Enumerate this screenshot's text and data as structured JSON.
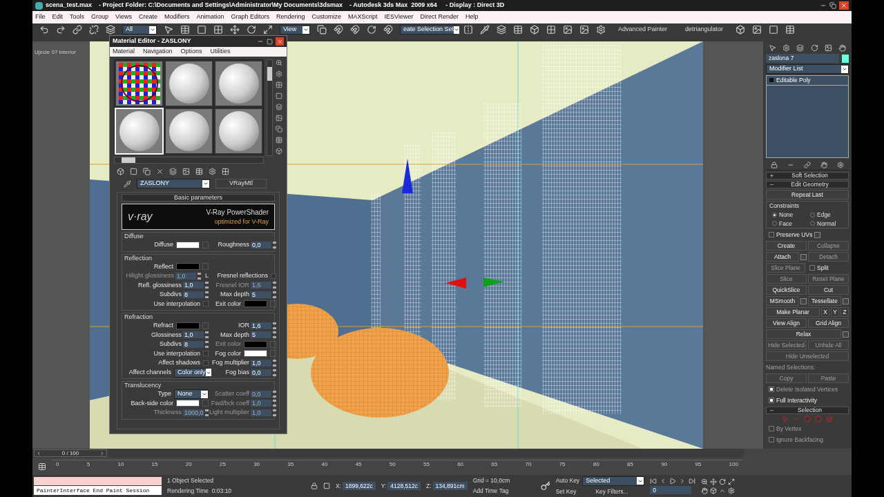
{
  "window": {
    "title": "scena_test.max    - Project Folder: C:\\Documents and Settings\\Administrator\\My Documents\\3dsmax    - Autodesk 3ds Max  2009 x64     - Display : Direct 3D"
  },
  "menu": [
    "File",
    "Edit",
    "Tools",
    "Group",
    "Views",
    "Create",
    "Modifiers",
    "Animation",
    "Graph Editors",
    "Rendering",
    "Customize",
    "MAXScript",
    "IESViewer",
    "Direct Render",
    "Help"
  ],
  "toolbar": {
    "selection_filter": "All",
    "reference_coord": "View",
    "named_selection": "eate Selection Set",
    "buttons": [
      "Advanced Painter",
      "detriangulator"
    ]
  },
  "viewport": {
    "label": "Ujecie 07 interior"
  },
  "material_editor": {
    "title": "Material Editor - ZASLONY",
    "menu": [
      "Material",
      "Navigation",
      "Options",
      "Utilities"
    ],
    "slots": [
      {
        "kind": "checker",
        "selected": false
      },
      {
        "kind": "sphere",
        "selected": false
      },
      {
        "kind": "sphere",
        "selected": false
      },
      {
        "kind": "sphere",
        "selected": true
      },
      {
        "kind": "sphere",
        "selected": false
      },
      {
        "kind": "sphere",
        "selected": false
      }
    ],
    "material_name": "ZASLONY",
    "material_type": "VRayMtl",
    "rollout": "Basic parameters",
    "banner": {
      "logo": "v·ray",
      "title": "V-Ray PowerShader",
      "subtitle": "optimized for V-Ray"
    },
    "groups": [
      {
        "title": "Diffuse",
        "rows": [
          {
            "left": {
              "kind": "color",
              "label": "Diffuse",
              "color": "#ffffff",
              "disabled": false
            },
            "right": {
              "kind": "spinner",
              "label": "Roughness",
              "value": "0,0",
              "disabled": false
            }
          }
        ]
      },
      {
        "title": "Reflection",
        "rows": [
          {
            "left": {
              "kind": "color",
              "label": "Reflect",
              "color": "#000000",
              "disabled": false
            }
          },
          {
            "left": {
              "kind": "spinner",
              "label": "Hilight glossiness",
              "value": "1,0",
              "disabled": true,
              "lock": "L"
            },
            "right": {
              "kind": "checkbox",
              "label": "Fresnel reflections",
              "checked": false,
              "disabled": false
            }
          },
          {
            "left": {
              "kind": "spinner",
              "label": "Refl. glossiness",
              "value": "1,0",
              "disabled": false
            },
            "right": {
              "kind": "spinner",
              "label": "Fresnel IOR",
              "value": "1,6",
              "disabled": true
            }
          },
          {
            "left": {
              "kind": "spinner",
              "label": "Subdivs",
              "value": "8",
              "disabled": false
            },
            "right": {
              "kind": "spinner",
              "label": "Max depth",
              "value": "5",
              "disabled": false
            }
          },
          {
            "left": {
              "kind": "checkbox",
              "label": "Use interpolation",
              "checked": false,
              "disabled": false
            },
            "right": {
              "kind": "color",
              "label": "Exit color",
              "color": "#000000",
              "disabled": false
            }
          }
        ]
      },
      {
        "title": "Refraction",
        "rows": [
          {
            "left": {
              "kind": "color",
              "label": "Refract",
              "color": "#000000",
              "disabled": false
            },
            "right": {
              "kind": "spinner",
              "label": "IOR",
              "value": "1,6",
              "disabled": false
            }
          },
          {
            "left": {
              "kind": "spinner",
              "label": "Glossiness",
              "value": "1,0",
              "disabled": false
            },
            "right": {
              "kind": "spinner",
              "label": "Max depth",
              "value": "5",
              "disabled": false
            }
          },
          {
            "left": {
              "kind": "spinner",
              "label": "Subdivs",
              "value": "8",
              "disabled": false
            },
            "right": {
              "kind": "color",
              "label": "Exit color",
              "color": "#000000",
              "disabled": true
            }
          },
          {
            "left": {
              "kind": "checkbox",
              "label": "Use interpolation",
              "checked": false,
              "disabled": false
            },
            "right": {
              "kind": "color",
              "label": "Fog color",
              "color": "#ffffff",
              "disabled": false
            }
          },
          {
            "left": {
              "kind": "checkbox",
              "label": "Affect shadows",
              "checked": false,
              "disabled": false
            },
            "right": {
              "kind": "spinner",
              "label": "Fog multiplier",
              "value": "1,0",
              "disabled": false
            }
          },
          {
            "left": {
              "kind": "dropdown",
              "label": "Affect channels",
              "value": "Color only",
              "disabled": false
            },
            "right": {
              "kind": "spinner",
              "label": "Fog bias",
              "value": "0,0",
              "disabled": false
            }
          }
        ]
      },
      {
        "title": "Translucency",
        "rows": [
          {
            "left": {
              "kind": "dropdown",
              "label": "Type",
              "value": "None",
              "disabled": false
            },
            "right": {
              "kind": "spinner",
              "label": "Scatter coeff",
              "value": "0,0",
              "disabled": true
            }
          },
          {
            "left": {
              "kind": "color",
              "label": "Back-side color",
              "color": "#ffffff",
              "disabled": false
            },
            "right": {
              "kind": "spinner",
              "label": "Fwd/bck coeff",
              "value": "1,0",
              "disabled": true
            }
          },
          {
            "left": {
              "kind": "spinner",
              "label": "Thickness",
              "value": "1000,0",
              "disabled": true
            },
            "right": {
              "kind": "spinner",
              "label": "Light multiplier",
              "value": "1,0",
              "disabled": true
            }
          }
        ]
      }
    ]
  },
  "command_panel": {
    "object": {
      "name": "zaslona 7",
      "color": "#66ffe0"
    },
    "modifier_list": "Modifier List",
    "stack": [
      "Editable Poly"
    ],
    "rollouts": [
      {
        "title": "Soft Selection",
        "expanded": false
      },
      {
        "title": "Edit Geometry",
        "expanded": true,
        "rows": [
          [
            {
              "kind": "button",
              "label": "Repeat Last",
              "disabled": false
            }
          ],
          [
            {
              "kind": "group",
              "label": "Constraints",
              "options": [
                {
                  "label": "None",
                  "selected": true
                },
                {
                  "label": "Edge",
                  "selected": false
                },
                {
                  "label": "Face",
                  "selected": false
                },
                {
                  "label": "Normal",
                  "selected": false
                }
              ]
            }
          ],
          [
            {
              "kind": "checkbox",
              "label": "Preserve UVs",
              "checked": false,
              "disabled": false,
              "settings": true
            }
          ],
          [
            {
              "kind": "button",
              "label": "Create",
              "disabled": false
            },
            {
              "kind": "button",
              "label": "Collapse",
              "disabled": true
            }
          ],
          [
            {
              "kind": "button",
              "label": "Attach",
              "disabled": false,
              "settings": true
            },
            {
              "kind": "button",
              "label": "Detach",
              "disabled": true
            }
          ],
          [
            {
              "kind": "button",
              "label": "Slice Plane",
              "disabled": true
            },
            {
              "kind": "checkbox",
              "label": "Split",
              "checked": false,
              "disabled": false
            }
          ],
          [
            {
              "kind": "button",
              "label": "Slice",
              "disabled": true
            },
            {
              "kind": "button",
              "label": "Reset Plane",
              "disabled": true
            }
          ],
          [
            {
              "kind": "button",
              "label": "QuickSlice",
              "disabled": false
            },
            {
              "kind": "button",
              "label": "Cut",
              "disabled": false
            }
          ],
          [
            {
              "kind": "button",
              "label": "MSmooth",
              "disabled": false,
              "settings": true
            },
            {
              "kind": "button",
              "label": "Tessellate",
              "disabled": false,
              "settings": true
            }
          ],
          [
            {
              "kind": "button",
              "label": "Make Planar",
              "disabled": false
            },
            {
              "kind": "small",
              "label": "X",
              "disabled": false
            },
            {
              "kind": "small",
              "label": "Y",
              "disabled": false
            },
            {
              "kind": "small",
              "label": "Z",
              "disabled": false
            }
          ],
          [
            {
              "kind": "button",
              "label": "View Align",
              "disabled": false
            },
            {
              "kind": "button",
              "label": "Grid Align",
              "disabled": false
            }
          ],
          [
            {
              "kind": "button",
              "label": "Relax",
              "disabled": false,
              "settings": true
            }
          ],
          [
            {
              "kind": "button",
              "label": "Hide Selected",
              "disabled": true
            },
            {
              "kind": "button",
              "label": "Unhide All",
              "disabled": true
            }
          ],
          [
            {
              "kind": "button",
              "label": "Hide Unselected",
              "disabled": true
            }
          ],
          [
            {
              "kind": "label",
              "label": "Named Selections:",
              "disabled": true
            }
          ],
          [
            {
              "kind": "button",
              "label": "Copy",
              "disabled": true
            },
            {
              "kind": "button",
              "label": "Paste",
              "disabled": true
            }
          ],
          [
            {
              "kind": "checkbox",
              "label": "Delete Isolated Vertices",
              "checked": true,
              "disabled": true
            }
          ],
          [
            {
              "kind": "checkbox",
              "label": "Full Interactivity",
              "checked": true,
              "disabled": false
            }
          ]
        ]
      },
      {
        "title": "Selection",
        "expanded": true,
        "rows": [
          [
            {
              "kind": "checkbox",
              "label": "By Vertex",
              "checked": false,
              "disabled": true
            }
          ],
          [
            {
              "kind": "checkbox",
              "label": "Ignore Backfacing",
              "checked": false,
              "disabled": true
            }
          ]
        ]
      }
    ]
  },
  "timeline": {
    "frame": "0 / 100",
    "level": 0,
    "ticks": [
      "0",
      "5",
      "10",
      "15",
      "20",
      "25",
      "30",
      "35",
      "40",
      "45",
      "50",
      "55",
      "60",
      "65",
      "70",
      "75",
      "80",
      "85",
      "90",
      "95",
      "100"
    ]
  },
  "status_bar": {
    "prompt": "PainterInterface End Paint Session",
    "status": "1 Object Selected",
    "render_time": "Rendering Time  0:03:10",
    "coords": [
      {
        "axis": "X:",
        "value": "1899,622c"
      },
      {
        "axis": "Y:",
        "value": "4128,512c"
      },
      {
        "axis": "Z:",
        "value": "134,891cm"
      }
    ],
    "grid": "Grid = 10,0cm",
    "time_tag": "Add Time Tag",
    "auto_key": "Auto Key",
    "key_mode": "Selected",
    "set_key": "Set Key",
    "key_filters": "Key Filters...",
    "current_frame": "0"
  }
}
